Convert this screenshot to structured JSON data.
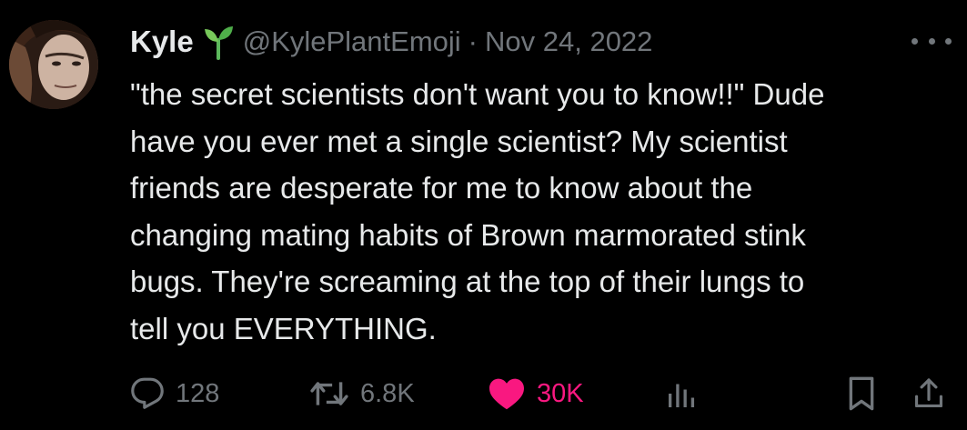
{
  "tweet": {
    "author": {
      "name": "Kyle",
      "badge_icon": "sprout-icon",
      "handle": "@KylePlantEmoji",
      "separator": "·",
      "date": "Nov 24, 2022"
    },
    "text_lines": [
      "\"the secret scientists don't want you to know!!\" Dude",
      "have you ever met a single scientist? My scientist",
      "friends are desperate for me to know about the",
      "changing mating habits of Brown marmorated stink",
      "bugs. They're screaming at the top of their lungs to",
      "tell you EVERYTHING."
    ],
    "stats": {
      "replies": "128",
      "retweets": "6.8K",
      "likes": "30K"
    },
    "liked": true
  },
  "colors": {
    "background": "#000000",
    "text": "#e7e9ea",
    "muted": "#71767b",
    "like": "#f91880",
    "sprout": "#5cb85c"
  }
}
